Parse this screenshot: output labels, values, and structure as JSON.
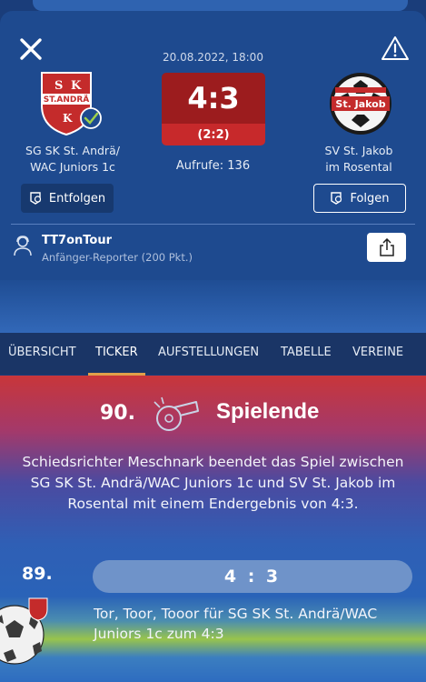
{
  "match": {
    "date": "20.08.2022, 18:00",
    "score": "4:3",
    "halftime": "(2:2)",
    "views": "Aufrufe: 136",
    "home": {
      "name_line1": "SG SK St. Andrä/",
      "name_line2": "WAC Juniors 1c",
      "button": "Entfolgen"
    },
    "away": {
      "name_line1": "SV St. Jakob",
      "name_line2": "im Rosental",
      "button": "Folgen"
    }
  },
  "reporter": {
    "name": "TT7onTour",
    "level": "Anfänger-Reporter (200 Pkt.)"
  },
  "tabs": [
    {
      "label": "ÜBERSICHT"
    },
    {
      "label": "TICKER"
    },
    {
      "label": "AUFSTELLUNGEN"
    },
    {
      "label": "TABELLE"
    },
    {
      "label": "VEREINE"
    }
  ],
  "ticker": [
    {
      "minute": "90.",
      "title": "Spielende",
      "text": "Schiedsrichter Meschnark beendet das Spiel zwischen SG SK St. Andrä/WAC Juniors 1c und SV St. Jakob im Rosental mit einem Endergebnis von 4:3."
    },
    {
      "minute": "89.",
      "score": "4 : 3",
      "text": "Tor, Toor, Tooor für SG SK St. Andrä/WAC Juniors 1c zum 4:3"
    }
  ],
  "colors": {
    "header_bg": "#1e4a8f",
    "score_red": "#9c1c1e",
    "tab_accent": "#e0a04a"
  },
  "icons": [
    "close-icon",
    "warning-icon",
    "bell-icon",
    "reporter-icon",
    "share-icon",
    "whistle-icon",
    "football-icon"
  ]
}
